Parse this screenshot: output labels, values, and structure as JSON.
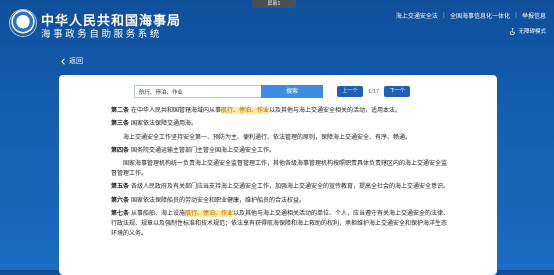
{
  "tab": {
    "label": "屏幕1"
  },
  "header": {
    "title": "中华人民共和国海事局",
    "subtitle": "海事政务自助服务系统",
    "nav": [
      {
        "label": "海上交通安全法"
      },
      {
        "label": "全国海事信息化一体化"
      },
      {
        "label": "举报信息"
      }
    ],
    "accessibility_label": "无障碍模式"
  },
  "back": {
    "label": "返回"
  },
  "search": {
    "value": "航行、停泊、作业",
    "button_label": "搜索",
    "prev_label": "上一个",
    "next_label": "下一个",
    "count": "1/17"
  },
  "document": {
    "paragraphs": [
      {
        "article": "第二条",
        "segments": [
          {
            "text": "在中华人民共和国管辖海域内从事"
          },
          {
            "text": "航行、停泊、作业",
            "highlight": true
          },
          {
            "text": "以及其他与海上交通安全相关的活动，适用本法。"
          }
        ]
      },
      {
        "article": "第三条",
        "segments": [
          {
            "text": "国家依法保障交通用海。"
          }
        ]
      },
      {
        "article": "",
        "segments": [
          {
            "text": "海上交通安全工作坚持安全第一、预防为主、便利通行、依法管理的原则，保障海上交通安全、有序、畅通。"
          }
        ]
      },
      {
        "article": "第四条",
        "segments": [
          {
            "text": "国务院交通运输主管部门主管全国海上交通安全工作。"
          }
        ]
      },
      {
        "article": "",
        "segments": [
          {
            "text": "国家海事管理机构统一负责海上交通安全监督管理工作，其他各级海事管理机构按照职责具体负责辖区内的海上交通安全监督管理工作。"
          }
        ]
      },
      {
        "article": "第五条",
        "segments": [
          {
            "text": "各级人民政府及有关部门应当支持海上交通安全工作，加强海上交通安全的宣传教育，提高全社会的海上交通安全意识。"
          }
        ]
      },
      {
        "article": "第六条",
        "segments": [
          {
            "text": "国家依法保障船员的劳动安全和职业健康，维护船员的合法权益。"
          }
        ]
      },
      {
        "article": "第七条",
        "segments": [
          {
            "text": "从事船舶、海上设施"
          },
          {
            "text": "航行、停泊、作业",
            "highlight": true
          },
          {
            "text": "以及其他与海上交通相关活动的单位、个人，应当遵守有关海上交通安全的法律、行政法规、规章以及强制性标准和技术规范；依法享有获得航海保障和海上救助的权利，承担维护海上交通安全和保护海洋生态环境的义务。"
          }
        ]
      }
    ]
  }
}
